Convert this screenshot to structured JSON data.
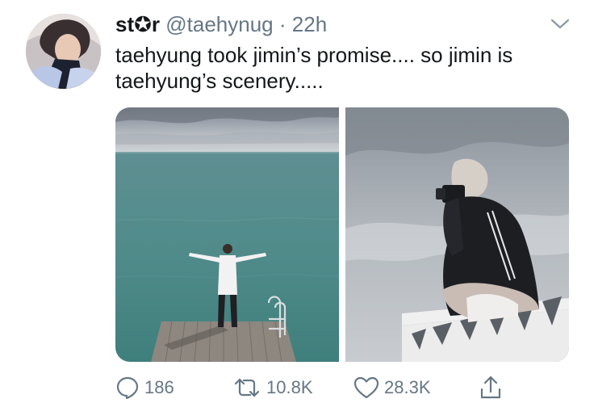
{
  "tweet": {
    "display_name": "st✪r",
    "handle": "@taehynug",
    "separator": "·",
    "time": "22h",
    "text_line1": "taehyung took jimin’s promise.... so jimin is",
    "text_line2": "taehyung’s scenery....."
  },
  "actions": {
    "replies": "186",
    "retweets": "10.8K",
    "likes": "28.3K"
  },
  "icons": {
    "reply": "speech-bubble-icon",
    "retweet": "retweet-arrows-icon",
    "like": "heart-icon",
    "share": "share-upload-icon",
    "menu": "chevron-down-icon"
  },
  "colors": {
    "text": "#14171a",
    "muted": "#657786"
  }
}
